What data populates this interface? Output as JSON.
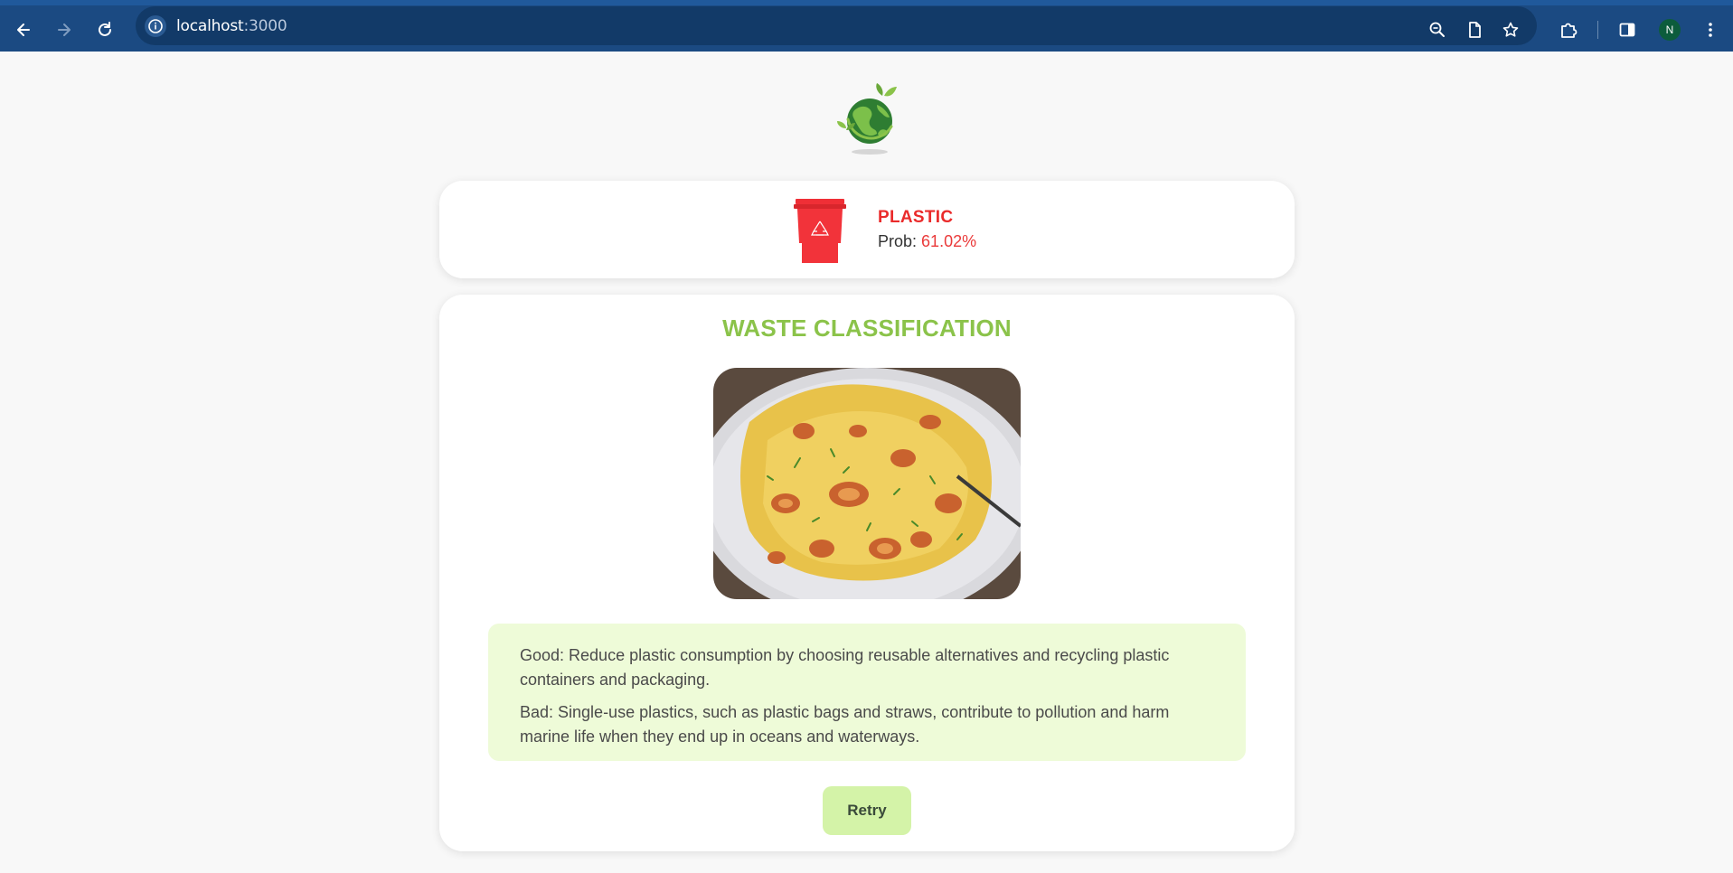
{
  "browser": {
    "url_host": "localhost",
    "url_port": ":3000",
    "profile_initial": "N"
  },
  "result": {
    "label": "PLASTIC",
    "prob_label": "Prob:",
    "prob_value": "61.02%",
    "color": "#ea2b2b"
  },
  "main": {
    "title": "WASTE CLASSIFICATION",
    "good_text": "Good: Reduce plastic consumption by choosing reusable alternatives and recycling plastic containers and packaging.",
    "bad_text": "Bad: Single-use plastics, such as plastic bags and straws, contribute to pollution and harm marine life when they end up in oceans and waterways.",
    "retry_label": "Retry"
  },
  "colors": {
    "accent_green": "#8bc34a",
    "info_bg": "#eefbd8",
    "retry_bg": "#d4f3a8",
    "chrome_bg": "#1b4a82"
  }
}
